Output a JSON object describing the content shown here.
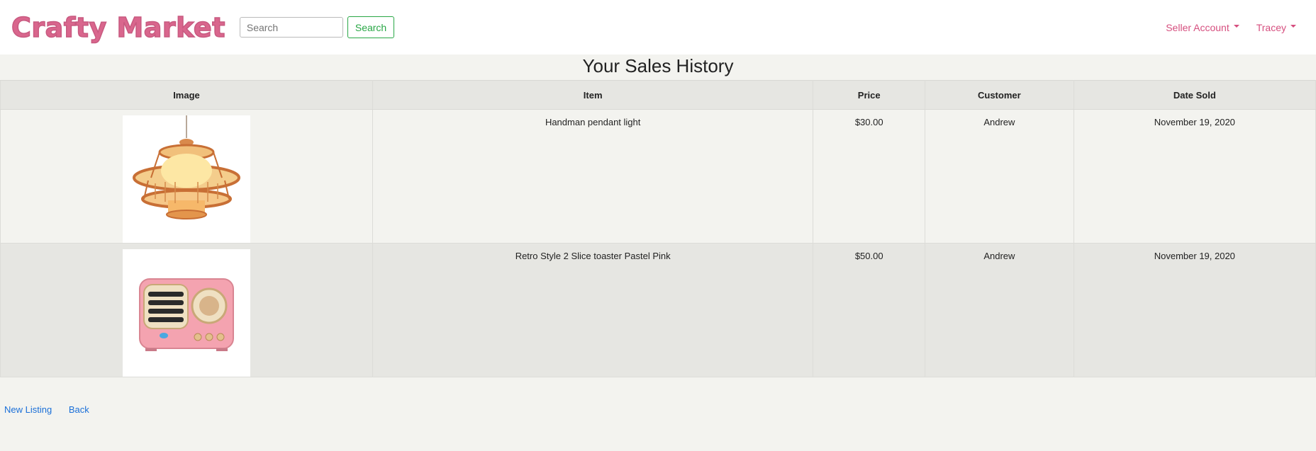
{
  "navbar": {
    "brand": "Crafty Market",
    "search_placeholder": "Search",
    "search_button": "Search",
    "seller_menu": "Seller Account",
    "user_menu": "Tracey"
  },
  "page": {
    "title": "Your Sales History"
  },
  "table": {
    "headers": [
      "Image",
      "Item",
      "Price",
      "Customer",
      "Date Sold"
    ],
    "rows": [
      {
        "image_icon": "pendant-lamp-image",
        "item": "Handman pendant light",
        "price": "$30.00",
        "customer": "Andrew",
        "date": "November 19, 2020"
      },
      {
        "image_icon": "pink-radio-image",
        "item": "Retro Style 2 Slice toaster Pastel Pink",
        "price": "$50.00",
        "customer": "Andrew",
        "date": "November 19, 2020"
      }
    ]
  },
  "footer": {
    "new_listing": "New Listing",
    "back": "Back"
  },
  "colors": {
    "brand": "#d9668d",
    "link": "#1a6fd8",
    "success": "#28a745"
  }
}
